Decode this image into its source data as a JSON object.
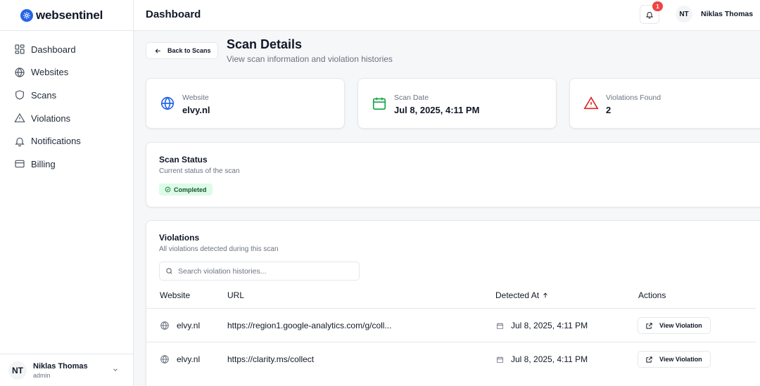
{
  "brand": {
    "name": "websentinel",
    "accent": "#2563eb"
  },
  "sidebar": {
    "items": [
      {
        "label": "Dashboard",
        "icon": "dashboard-grid-icon"
      },
      {
        "label": "Websites",
        "icon": "globe-icon"
      },
      {
        "label": "Scans",
        "icon": "shield-icon"
      },
      {
        "label": "Violations",
        "icon": "warning-triangle-icon"
      },
      {
        "label": "Notifications",
        "icon": "bell-icon"
      },
      {
        "label": "Billing",
        "icon": "credit-card-icon"
      }
    ],
    "user": {
      "initials": "NT",
      "name": "Niklas Thomas",
      "role": "admin"
    }
  },
  "header": {
    "title": "Dashboard",
    "notification_count": "1",
    "user_initials": "NT",
    "user_name": "Niklas Thomas"
  },
  "page": {
    "back_label": "Back to Scans",
    "title": "Scan Details",
    "subtitle": "View scan information and violation histories"
  },
  "summary": {
    "website": {
      "label": "Website",
      "value": "elvy.nl",
      "color": "#2563eb"
    },
    "scan_date": {
      "label": "Scan Date",
      "value": "Jul 8, 2025, 4:11 PM",
      "color": "#16a34a"
    },
    "violations": {
      "label": "Violations Found",
      "value": "2",
      "color": "#dc2626"
    }
  },
  "status": {
    "title": "Scan Status",
    "subtitle": "Current status of the scan",
    "badge": "Completed",
    "badge_bg": "#dcfce7"
  },
  "violations": {
    "title": "Violations",
    "subtitle": "All violations detected during this scan",
    "search_placeholder": "Search violation histories...",
    "columns": {
      "website": "Website",
      "url": "URL",
      "detected_at": "Detected At",
      "actions": "Actions"
    },
    "rows": [
      {
        "website": "elvy.nl",
        "url": "https://region1.google-analytics.com/g/coll...",
        "detected_at": "Jul 8, 2025, 4:11 PM",
        "action": "View Violation"
      },
      {
        "website": "elvy.nl",
        "url": "https://clarity.ms/collect",
        "detected_at": "Jul 8, 2025, 4:11 PM",
        "action": "View Violation"
      }
    ]
  }
}
